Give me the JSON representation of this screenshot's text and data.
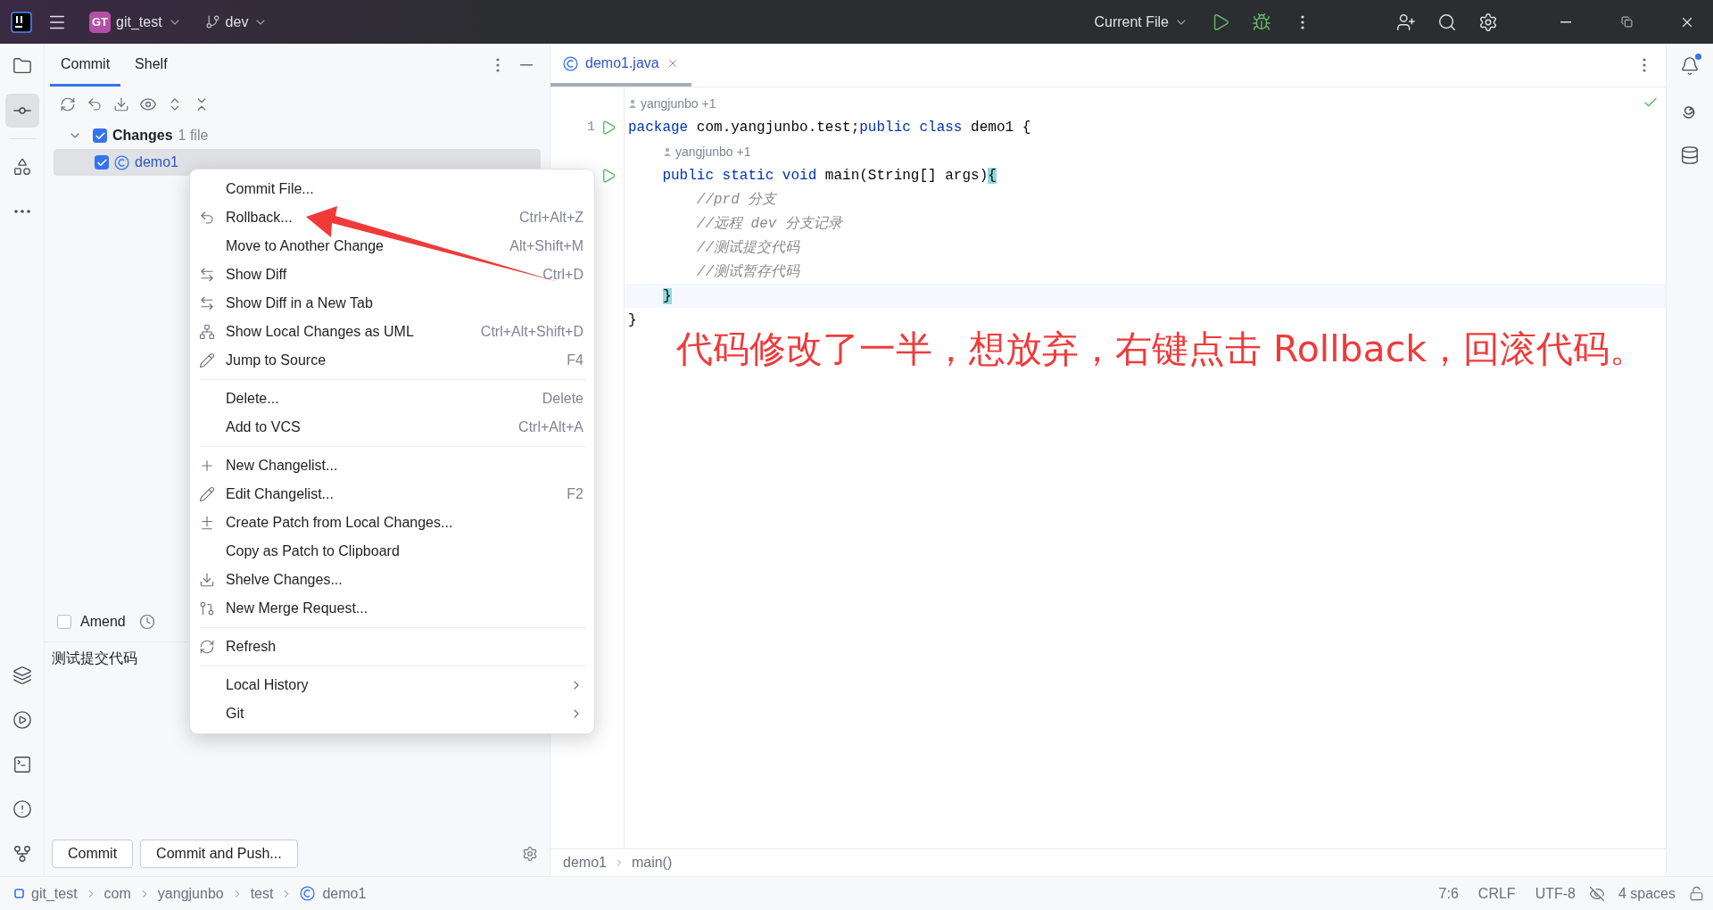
{
  "title_bar": {
    "project_badge": "GT",
    "project": "git_test",
    "branch": "dev",
    "run_config": "Current File"
  },
  "commit_panel": {
    "tabs": [
      {
        "label": "Commit",
        "selected": true
      },
      {
        "label": "Shelf",
        "selected": false
      }
    ],
    "tree": [
      {
        "label": "Changes",
        "count": "1 file",
        "checked": true,
        "expanded": true,
        "children": [
          {
            "label": "demo1",
            "checked": true,
            "selected": true
          }
        ]
      }
    ],
    "amend": {
      "label": "Amend",
      "checked": false
    },
    "message": "测试提交代码",
    "buttons": [
      "Commit",
      "Commit and Push..."
    ]
  },
  "context_menu": {
    "items": [
      {
        "kind": "item",
        "label": "Commit File..."
      },
      {
        "kind": "item",
        "label": "Rollback...",
        "shortcut": "Ctrl+Alt+Z"
      },
      {
        "kind": "item",
        "label": "Move to Another Change",
        "shortcut": "Alt+Shift+M"
      },
      {
        "kind": "item",
        "label": "Show Diff",
        "shortcut": "Ctrl+D"
      },
      {
        "kind": "item",
        "label": "Show Diff in a New Tab"
      },
      {
        "kind": "item",
        "label": "Show Local Changes as UML",
        "shortcut": "Ctrl+Alt+Shift+D"
      },
      {
        "kind": "item",
        "label": "Jump to Source",
        "shortcut": "F4"
      },
      {
        "kind": "separator"
      },
      {
        "kind": "item",
        "label": "Delete...",
        "shortcut": "Delete"
      },
      {
        "kind": "item",
        "label": "Add to VCS",
        "shortcut": "Ctrl+Alt+A"
      },
      {
        "kind": "separator"
      },
      {
        "kind": "item",
        "label": "New Changelist..."
      },
      {
        "kind": "item",
        "label": "Edit Changelist...",
        "shortcut": "F2"
      },
      {
        "kind": "item",
        "label": "Create Patch from Local Changes..."
      },
      {
        "kind": "item",
        "label": "Copy as Patch to Clipboard"
      },
      {
        "kind": "item",
        "label": "Shelve Changes..."
      },
      {
        "kind": "item",
        "label": "New Merge Request..."
      },
      {
        "kind": "separator"
      },
      {
        "kind": "item",
        "label": "Refresh"
      },
      {
        "kind": "separator"
      },
      {
        "kind": "submenu",
        "label": "Local History"
      },
      {
        "kind": "submenu",
        "label": "Git"
      }
    ]
  },
  "editor": {
    "tabs": [
      {
        "label": "demo1.java",
        "selected": true
      }
    ],
    "lines": [
      {
        "kind": "author",
        "text": "yangjunbo +1"
      },
      {
        "kind": "code",
        "number": "1",
        "run": true,
        "tokens": [
          {
            "kind": "keyword",
            "text": "package"
          },
          {
            "kind": "plain",
            "text": " com.yangjunbo.test;"
          },
          {
            "kind": "keyword",
            "text": "public class"
          },
          {
            "kind": "plain",
            "text": " demo1 {"
          }
        ]
      },
      {
        "kind": "nestedauthor",
        "text": "yangjunbo +1"
      },
      {
        "kind": "code",
        "run": true,
        "tokens": [
          {
            "kind": "keyword",
            "text": "    public static void"
          },
          {
            "kind": "plain",
            "text": " main(String[] args)"
          },
          {
            "kind": "match",
            "text": "{"
          }
        ]
      },
      {
        "kind": "code",
        "tokens": [
          {
            "kind": "comment",
            "text": "        //prd 分支"
          }
        ]
      },
      {
        "kind": "code",
        "tokens": [
          {
            "kind": "comment",
            "text": "        //远程 dev 分支记录"
          }
        ]
      },
      {
        "kind": "code",
        "tokens": [
          {
            "kind": "comment",
            "text": "        //测试提交代码"
          }
        ]
      },
      {
        "kind": "code",
        "tokens": [
          {
            "kind": "comment",
            "text": "        //测试暂存代码"
          }
        ]
      },
      {
        "kind": "nestedcode",
        "current": true,
        "tokens": [
          {
            "kind": "match",
            "text": "}"
          }
        ]
      },
      {
        "kind": "code",
        "tokens": [
          {
            "kind": "plain",
            "text": "}"
          }
        ]
      }
    ],
    "breadcrumbs": [
      "demo1",
      "main()"
    ]
  },
  "annotation": "代码修改了一半，想放弃，右键点击 Rollback，回滚代码。",
  "status_bar": {
    "path": [
      {
        "kind": "module",
        "text": "git_test"
      },
      {
        "kind": "package",
        "text": "com"
      },
      {
        "kind": "package",
        "text": "yangjunbo"
      },
      {
        "kind": "package",
        "text": "test"
      },
      {
        "kind": "class",
        "text": "demo1"
      }
    ],
    "items": [
      "7:6",
      "CRLF",
      "UTF-8",
      "4 spaces"
    ]
  }
}
